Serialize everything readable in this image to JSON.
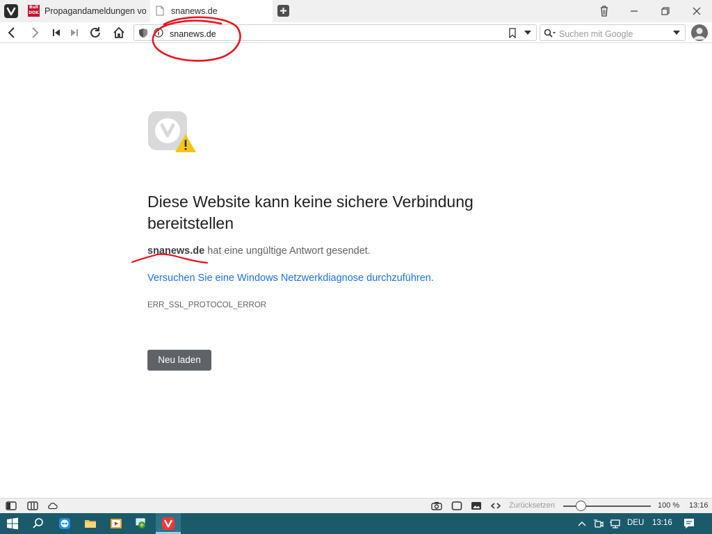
{
  "tabs": [
    {
      "title": "Propagandameldungen von",
      "favicon": "bulldok-logo-icon"
    },
    {
      "title": "snanews.de",
      "favicon": "page-icon"
    }
  ],
  "favicon_logo": {
    "top": "Bull",
    "bottom": "DOK"
  },
  "address_bar": {
    "url": "snanews.de"
  },
  "search": {
    "placeholder": "Suchen mit Google"
  },
  "error_page": {
    "heading": "Diese Website kann keine sichere Verbindung bereitstellen",
    "host": "snanews.de",
    "description": " hat eine ungültige Antwort gesendet.",
    "diagnose_link": "Versuchen Sie eine Windows Netzwerkdiagnose durchzuführen.",
    "error_code": "ERR_SSL_PROTOCOL_ERROR",
    "reload_button": "Neu laden"
  },
  "status_bar": {
    "reset_label": "Zurücksetzen",
    "zoom": "100 %",
    "zoom_fraction": 0.2,
    "time": "13:16"
  },
  "taskbar": {
    "language": "DEU",
    "time": "13:16"
  },
  "colors": {
    "annotation": "#e8131d",
    "link": "#1a73e8",
    "taskbar": "#1b5a6b",
    "vivaldi_red": "#ef3939"
  }
}
